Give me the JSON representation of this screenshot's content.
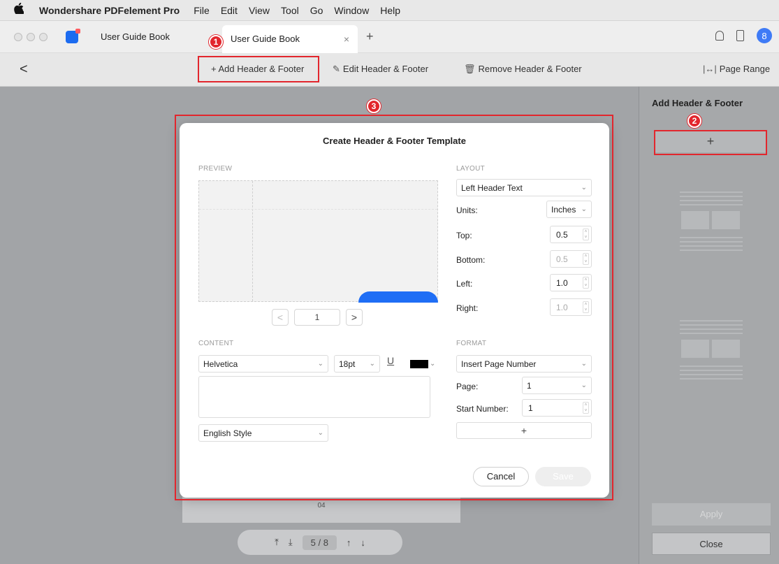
{
  "menubar": {
    "apple_icon": "apple-logo-icon",
    "app_name": "Wondershare PDFelement Pro",
    "items": [
      "File",
      "Edit",
      "View",
      "Tool",
      "Go",
      "Window",
      "Help"
    ]
  },
  "tabs": {
    "inactive_label": "User Guide Book",
    "active_label": "User Guide Book",
    "close_glyph": "×",
    "new_tab_glyph": "+",
    "user_glyph": "8"
  },
  "toolbar": {
    "back_glyph": "<",
    "add_label": "+ Add Header & Footer",
    "edit_label": "Edit Header & Footer",
    "remove_label": "Remove Header & Footer",
    "page_range_label": "Page Range"
  },
  "markers": {
    "m1": "1",
    "m2": "2",
    "m3": "3"
  },
  "dialog": {
    "title": "Create Header & Footer Template",
    "preview_label": "PREVIEW",
    "page_value": "1",
    "prev_glyph": "<",
    "next_glyph": ">",
    "layout": {
      "label": "LAYOUT",
      "position": "Left Header Text",
      "units_label": "Units:",
      "units_value": "Inches",
      "top_label": "Top:",
      "top_value": "0.5",
      "bottom_label": "Bottom:",
      "bottom_value": "0.5",
      "left_label": "Left:",
      "left_value": "1.0",
      "right_label": "Right:",
      "right_value": "1.0"
    },
    "content": {
      "label": "CONTENT",
      "font": "Helvetica",
      "size": "18pt",
      "underline_glyph": "U",
      "text_value": "",
      "style": "English Style",
      "color": "#000000"
    },
    "format": {
      "label": "FORMAT",
      "insert": "Insert Page Number",
      "page_label": "Page:",
      "page_value": "1",
      "start_label": "Start Number:",
      "start_value": "1",
      "plus_glyph": "+"
    },
    "cancel_label": "Cancel",
    "save_label": "Save"
  },
  "canvas": {
    "page_number_label": "04",
    "pager": {
      "first_glyph": "⤒",
      "down_glyph": "⤓",
      "current": "5",
      "sep": "/",
      "total": "8",
      "up_glyph": "↑",
      "down2_glyph": "↓"
    }
  },
  "right_panel": {
    "title": "Add Header & Footer",
    "add_glyph": "+",
    "apply_label": "Apply",
    "close_label": "Close"
  },
  "colors": {
    "accent": "#1f6ef5",
    "annotation_red": "#e2262d"
  }
}
